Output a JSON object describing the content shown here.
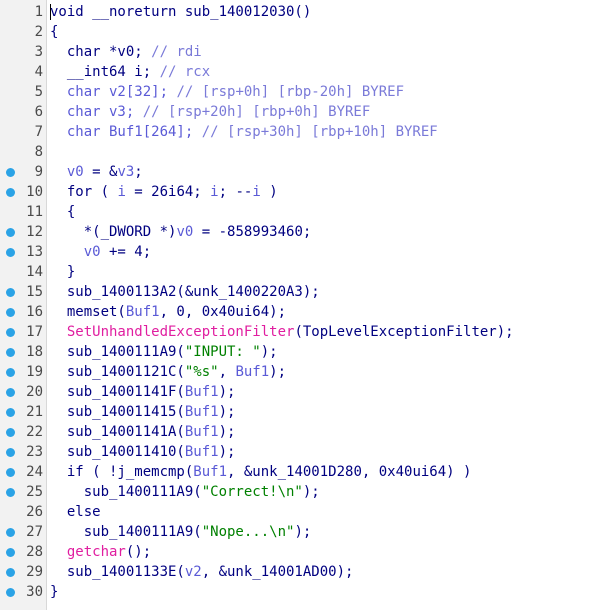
{
  "editor": {
    "lines": [
      {
        "n": "1",
        "dot": false,
        "code": [
          {
            "t": "void __noreturn sub_140012030()",
            "c": "k"
          }
        ]
      },
      {
        "n": "2",
        "dot": false,
        "code": [
          {
            "t": "{",
            "c": "k"
          }
        ]
      },
      {
        "n": "3",
        "dot": false,
        "code": [
          {
            "t": "  char *v0; ",
            "c": "k"
          },
          {
            "t": "// rdi",
            "c": "c"
          }
        ]
      },
      {
        "n": "4",
        "dot": false,
        "code": [
          {
            "t": "  __int64 i; ",
            "c": "k"
          },
          {
            "t": "// rcx",
            "c": "c"
          }
        ]
      },
      {
        "n": "5",
        "dot": false,
        "code": [
          {
            "t": "  char v2[32]; ",
            "c": "p"
          },
          {
            "t": "// [rsp+0h] [rbp-20h] BYREF",
            "c": "c"
          }
        ]
      },
      {
        "n": "6",
        "dot": false,
        "code": [
          {
            "t": "  char v3; ",
            "c": "p"
          },
          {
            "t": "// [rsp+20h] [rbp+0h] BYREF",
            "c": "c"
          }
        ]
      },
      {
        "n": "7",
        "dot": false,
        "code": [
          {
            "t": "  char Buf1[264]; ",
            "c": "p"
          },
          {
            "t": "// [rsp+30h] [rbp+10h] BYREF",
            "c": "c"
          }
        ]
      },
      {
        "n": "8",
        "dot": false,
        "code": [
          {
            "t": "",
            "c": "k"
          }
        ]
      },
      {
        "n": "9",
        "dot": true,
        "code": [
          {
            "t": "  v0",
            "c": "p"
          },
          {
            "t": " = &",
            "c": "k"
          },
          {
            "t": "v3",
            "c": "p"
          },
          {
            "t": ";",
            "c": "k"
          }
        ]
      },
      {
        "n": "10",
        "dot": true,
        "code": [
          {
            "t": "  for ( ",
            "c": "k"
          },
          {
            "t": "i",
            "c": "p"
          },
          {
            "t": " = 26i64; ",
            "c": "k"
          },
          {
            "t": "i",
            "c": "p"
          },
          {
            "t": "; --",
            "c": "k"
          },
          {
            "t": "i",
            "c": "p"
          },
          {
            "t": " )",
            "c": "k"
          }
        ]
      },
      {
        "n": "11",
        "dot": false,
        "code": [
          {
            "t": "  {",
            "c": "k"
          }
        ]
      },
      {
        "n": "12",
        "dot": true,
        "code": [
          {
            "t": "    *(_DWORD *)",
            "c": "k"
          },
          {
            "t": "v0",
            "c": "p"
          },
          {
            "t": " = -858993460;",
            "c": "k"
          }
        ]
      },
      {
        "n": "13",
        "dot": true,
        "code": [
          {
            "t": "    ",
            "c": "k"
          },
          {
            "t": "v0",
            "c": "p"
          },
          {
            "t": " += 4;",
            "c": "k"
          }
        ]
      },
      {
        "n": "14",
        "dot": false,
        "code": [
          {
            "t": "  }",
            "c": "k"
          }
        ]
      },
      {
        "n": "15",
        "dot": true,
        "code": [
          {
            "t": "  sub_1400113A2(&unk_1400220A3);",
            "c": "k"
          }
        ]
      },
      {
        "n": "16",
        "dot": true,
        "code": [
          {
            "t": "  memset(",
            "c": "k"
          },
          {
            "t": "Buf1",
            "c": "p"
          },
          {
            "t": ", 0, 0x40ui64);",
            "c": "k"
          }
        ]
      },
      {
        "n": "17",
        "dot": true,
        "code": [
          {
            "t": "  ",
            "c": "k"
          },
          {
            "t": "SetUnhandledExceptionFilter",
            "c": "f"
          },
          {
            "t": "(TopLevelExceptionFilter);",
            "c": "k"
          }
        ]
      },
      {
        "n": "18",
        "dot": true,
        "code": [
          {
            "t": "  sub_1400111A9(",
            "c": "k"
          },
          {
            "t": "\"INPUT: \"",
            "c": "s"
          },
          {
            "t": ");",
            "c": "k"
          }
        ]
      },
      {
        "n": "19",
        "dot": true,
        "code": [
          {
            "t": "  sub_14001121C(",
            "c": "k"
          },
          {
            "t": "\"%s\"",
            "c": "s"
          },
          {
            "t": ", ",
            "c": "k"
          },
          {
            "t": "Buf1",
            "c": "p"
          },
          {
            "t": ");",
            "c": "k"
          }
        ]
      },
      {
        "n": "20",
        "dot": true,
        "code": [
          {
            "t": "  sub_14001141F(",
            "c": "k"
          },
          {
            "t": "Buf1",
            "c": "p"
          },
          {
            "t": ");",
            "c": "k"
          }
        ]
      },
      {
        "n": "21",
        "dot": true,
        "code": [
          {
            "t": "  sub_140011415(",
            "c": "k"
          },
          {
            "t": "Buf1",
            "c": "p"
          },
          {
            "t": ");",
            "c": "k"
          }
        ]
      },
      {
        "n": "22",
        "dot": true,
        "code": [
          {
            "t": "  sub_14001141A(",
            "c": "k"
          },
          {
            "t": "Buf1",
            "c": "p"
          },
          {
            "t": ");",
            "c": "k"
          }
        ]
      },
      {
        "n": "23",
        "dot": true,
        "code": [
          {
            "t": "  sub_140011410(",
            "c": "k"
          },
          {
            "t": "Buf1",
            "c": "p"
          },
          {
            "t": ");",
            "c": "k"
          }
        ]
      },
      {
        "n": "24",
        "dot": true,
        "code": [
          {
            "t": "  if ( !j_memcmp(",
            "c": "k"
          },
          {
            "t": "Buf1",
            "c": "p"
          },
          {
            "t": ", &unk_14001D280, 0x40ui64) )",
            "c": "k"
          }
        ]
      },
      {
        "n": "25",
        "dot": true,
        "code": [
          {
            "t": "    sub_1400111A9(",
            "c": "k"
          },
          {
            "t": "\"Correct!\\n\"",
            "c": "s"
          },
          {
            "t": ");",
            "c": "k"
          }
        ]
      },
      {
        "n": "26",
        "dot": false,
        "code": [
          {
            "t": "  else",
            "c": "k"
          }
        ]
      },
      {
        "n": "27",
        "dot": true,
        "code": [
          {
            "t": "    sub_1400111A9(",
            "c": "k"
          },
          {
            "t": "\"Nope...\\n\"",
            "c": "s"
          },
          {
            "t": ");",
            "c": "k"
          }
        ]
      },
      {
        "n": "28",
        "dot": true,
        "code": [
          {
            "t": "  ",
            "c": "k"
          },
          {
            "t": "getchar",
            "c": "f"
          },
          {
            "t": "();",
            "c": "k"
          }
        ]
      },
      {
        "n": "29",
        "dot": true,
        "code": [
          {
            "t": "  sub_14001133E(",
            "c": "k"
          },
          {
            "t": "v2",
            "c": "p"
          },
          {
            "t": ", &unk_14001AD00);",
            "c": "k"
          }
        ]
      },
      {
        "n": "30",
        "dot": true,
        "code": [
          {
            "t": "}",
            "c": "k"
          }
        ]
      }
    ]
  }
}
